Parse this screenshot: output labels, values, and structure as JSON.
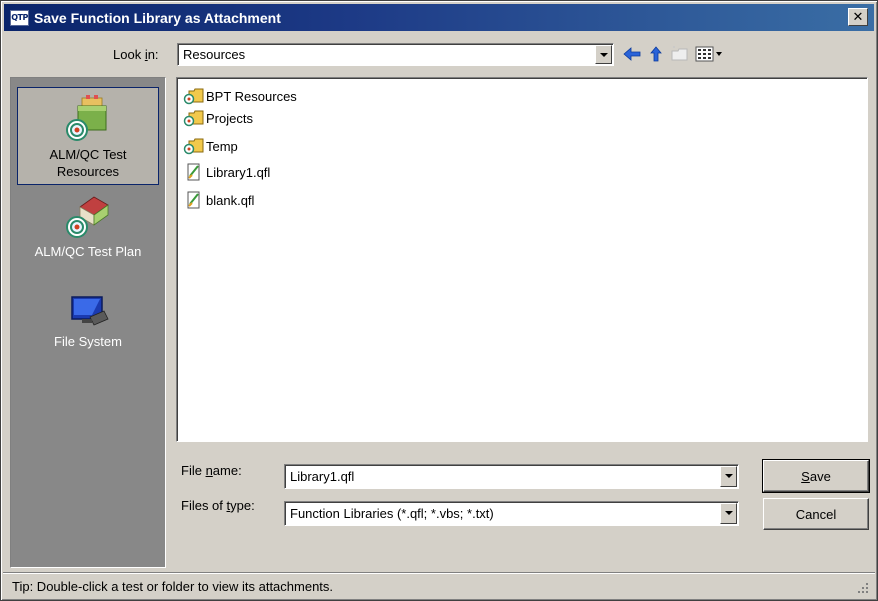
{
  "window": {
    "app_icon_text": "QTP",
    "title": "Save Function Library as Attachment",
    "close_glyph": "✕"
  },
  "lookin": {
    "label_pre": "Look ",
    "label_accel": "i",
    "label_post": "n:",
    "value": "Resources"
  },
  "toolbar": {
    "icons": [
      "back-arrow-icon",
      "up-folder-icon",
      "new-folder-icon",
      "view-menu-icon"
    ]
  },
  "places": [
    {
      "label": "ALM/QC Test Resources",
      "icon": "test-resources-icon",
      "selected": true
    },
    {
      "label": "ALM/QC Test Plan",
      "icon": "test-plan-icon",
      "selected": false
    },
    {
      "label": "File System",
      "icon": "file-system-icon",
      "selected": false
    }
  ],
  "files": [
    {
      "name": "BPT Resources",
      "type": "folder"
    },
    {
      "name": "Projects",
      "type": "folder"
    },
    {
      "name": "Temp",
      "type": "folder"
    },
    {
      "name": "Library1.qfl",
      "type": "qfl"
    },
    {
      "name": "blank.qfl",
      "type": "qfl"
    }
  ],
  "filename": {
    "label_pre": "File ",
    "label_accel": "n",
    "label_post": "ame:",
    "value": "Library1.qfl"
  },
  "filetype": {
    "label_pre": "Files of ",
    "label_accel": "t",
    "label_post": "ype:",
    "value": "Function Libraries (*.qfl; *.vbs; *.txt)"
  },
  "buttons": {
    "save_accel": "S",
    "save_rest": "ave",
    "cancel": "Cancel"
  },
  "status": {
    "tip": "Tip: Double-click a test or folder to view its attachments."
  },
  "colors": {
    "titlebar": "#0a246a",
    "dialog_bg": "#d4d0c8",
    "places_bg": "#888888",
    "folder_yellow": "#f2c94c"
  }
}
